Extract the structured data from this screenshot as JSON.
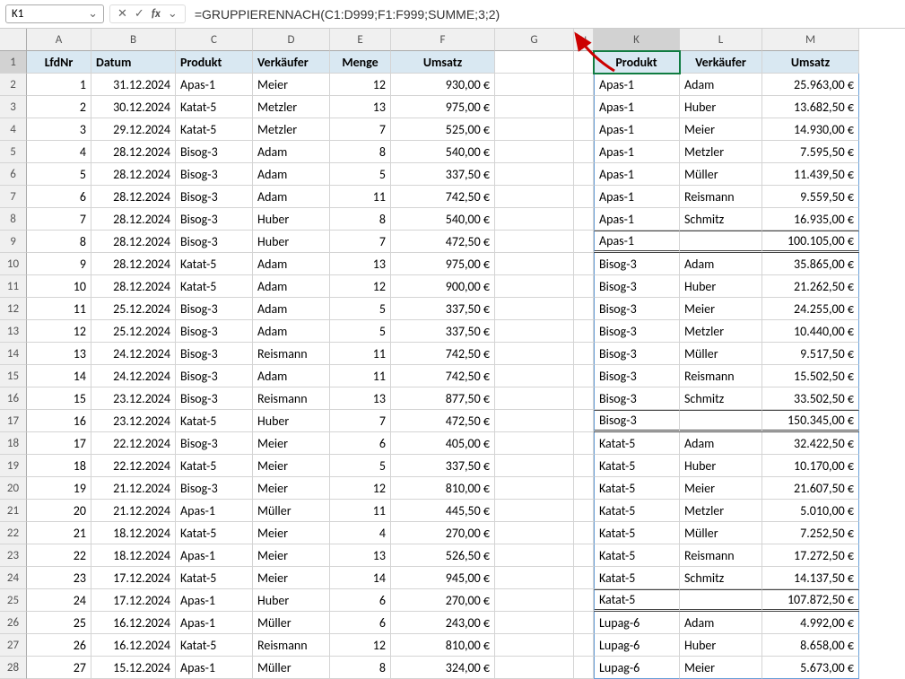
{
  "formula_bar": {
    "cell_ref": "K1",
    "formula": "=GRUPPIERENNACH(C1:D999;F1:F999;SUMME;3;2)",
    "cancel": "✕",
    "confirm": "✓",
    "fx": "fx",
    "dropdown": "⌄"
  },
  "col_letters": [
    "A",
    "B",
    "C",
    "D",
    "E",
    "F",
    "G",
    "H",
    "K",
    "L",
    "M"
  ],
  "row_numbers": [
    1,
    2,
    3,
    4,
    5,
    6,
    7,
    8,
    9,
    10,
    11,
    12,
    13,
    14,
    15,
    16,
    17,
    18,
    19,
    20,
    21,
    22,
    23,
    24,
    25,
    26,
    27,
    28
  ],
  "headers_left": [
    "LfdNr",
    "Datum",
    "Produkt",
    "Verkäufer",
    "Menge",
    "Umsatz"
  ],
  "headers_right": [
    "Produkt",
    "Verkäufer",
    "Umsatz"
  ],
  "rows_left": [
    {
      "n": 1,
      "d": "31.12.2024",
      "p": "Apas-1",
      "v": "Meier",
      "m": 12,
      "u": "930,00 €"
    },
    {
      "n": 2,
      "d": "30.12.2024",
      "p": "Katat-5",
      "v": "Metzler",
      "m": 13,
      "u": "975,00 €"
    },
    {
      "n": 3,
      "d": "29.12.2024",
      "p": "Katat-5",
      "v": "Metzler",
      "m": 7,
      "u": "525,00 €"
    },
    {
      "n": 4,
      "d": "28.12.2024",
      "p": "Bisog-3",
      "v": "Adam",
      "m": 8,
      "u": "540,00 €"
    },
    {
      "n": 5,
      "d": "28.12.2024",
      "p": "Bisog-3",
      "v": "Adam",
      "m": 5,
      "u": "337,50 €"
    },
    {
      "n": 6,
      "d": "28.12.2024",
      "p": "Bisog-3",
      "v": "Adam",
      "m": 11,
      "u": "742,50 €"
    },
    {
      "n": 7,
      "d": "28.12.2024",
      "p": "Bisog-3",
      "v": "Huber",
      "m": 8,
      "u": "540,00 €"
    },
    {
      "n": 8,
      "d": "28.12.2024",
      "p": "Bisog-3",
      "v": "Huber",
      "m": 7,
      "u": "472,50 €"
    },
    {
      "n": 9,
      "d": "28.12.2024",
      "p": "Katat-5",
      "v": "Adam",
      "m": 13,
      "u": "975,00 €"
    },
    {
      "n": 10,
      "d": "28.12.2024",
      "p": "Katat-5",
      "v": "Adam",
      "m": 12,
      "u": "900,00 €"
    },
    {
      "n": 11,
      "d": "25.12.2024",
      "p": "Bisog-3",
      "v": "Adam",
      "m": 5,
      "u": "337,50 €"
    },
    {
      "n": 12,
      "d": "25.12.2024",
      "p": "Bisog-3",
      "v": "Adam",
      "m": 5,
      "u": "337,50 €"
    },
    {
      "n": 13,
      "d": "24.12.2024",
      "p": "Bisog-3",
      "v": "Reismann",
      "m": 11,
      "u": "742,50 €"
    },
    {
      "n": 14,
      "d": "24.12.2024",
      "p": "Bisog-3",
      "v": "Adam",
      "m": 11,
      "u": "742,50 €"
    },
    {
      "n": 15,
      "d": "23.12.2024",
      "p": "Bisog-3",
      "v": "Reismann",
      "m": 13,
      "u": "877,50 €"
    },
    {
      "n": 16,
      "d": "23.12.2024",
      "p": "Katat-5",
      "v": "Huber",
      "m": 7,
      "u": "472,50 €"
    },
    {
      "n": 17,
      "d": "22.12.2024",
      "p": "Bisog-3",
      "v": "Meier",
      "m": 6,
      "u": "405,00 €"
    },
    {
      "n": 18,
      "d": "22.12.2024",
      "p": "Katat-5",
      "v": "Meier",
      "m": 5,
      "u": "337,50 €"
    },
    {
      "n": 19,
      "d": "21.12.2024",
      "p": "Bisog-3",
      "v": "Meier",
      "m": 12,
      "u": "810,00 €"
    },
    {
      "n": 20,
      "d": "21.12.2024",
      "p": "Apas-1",
      "v": "Müller",
      "m": 11,
      "u": "445,50 €"
    },
    {
      "n": 21,
      "d": "18.12.2024",
      "p": "Katat-5",
      "v": "Meier",
      "m": 4,
      "u": "270,00 €"
    },
    {
      "n": 22,
      "d": "18.12.2024",
      "p": "Apas-1",
      "v": "Meier",
      "m": 13,
      "u": "526,50 €"
    },
    {
      "n": 23,
      "d": "17.12.2024",
      "p": "Katat-5",
      "v": "Meier",
      "m": 14,
      "u": "945,00 €"
    },
    {
      "n": 24,
      "d": "17.12.2024",
      "p": "Apas-1",
      "v": "Huber",
      "m": 6,
      "u": "270,00 €"
    },
    {
      "n": 25,
      "d": "16.12.2024",
      "p": "Apas-1",
      "v": "Müller",
      "m": 6,
      "u": "243,00 €"
    },
    {
      "n": 26,
      "d": "16.12.2024",
      "p": "Katat-5",
      "v": "Reismann",
      "m": 12,
      "u": "810,00 €"
    },
    {
      "n": 27,
      "d": "15.12.2024",
      "p": "Apas-1",
      "v": "Müller",
      "m": 8,
      "u": "324,00 €"
    }
  ],
  "rows_right": [
    {
      "p": "Apas-1",
      "v": "Adam",
      "u": "25.963,00 €"
    },
    {
      "p": "Apas-1",
      "v": "Huber",
      "u": "13.682,50 €"
    },
    {
      "p": "Apas-1",
      "v": "Meier",
      "u": "14.930,00 €"
    },
    {
      "p": "Apas-1",
      "v": "Metzler",
      "u": "7.595,50 €"
    },
    {
      "p": "Apas-1",
      "v": "Müller",
      "u": "11.439,50 €"
    },
    {
      "p": "Apas-1",
      "v": "Reismann",
      "u": "9.559,50 €"
    },
    {
      "p": "Apas-1",
      "v": "Schmitz",
      "u": "16.935,00 €"
    },
    {
      "p": "Apas-1",
      "v": "",
      "u": "100.105,00 €",
      "sub": true
    },
    {
      "p": "Bisog-3",
      "v": "Adam",
      "u": "35.865,00 €"
    },
    {
      "p": "Bisog-3",
      "v": "Huber",
      "u": "21.262,50 €"
    },
    {
      "p": "Bisog-3",
      "v": "Meier",
      "u": "24.255,00 €"
    },
    {
      "p": "Bisog-3",
      "v": "Metzler",
      "u": "10.440,00 €"
    },
    {
      "p": "Bisog-3",
      "v": "Müller",
      "u": "9.517,50 €"
    },
    {
      "p": "Bisog-3",
      "v": "Reismann",
      "u": "15.502,50 €"
    },
    {
      "p": "Bisog-3",
      "v": "Schmitz",
      "u": "33.502,50 €"
    },
    {
      "p": "Bisog-3",
      "v": "",
      "u": "150.345,00 €",
      "sub": true
    },
    {
      "p": "Katat-5",
      "v": "Adam",
      "u": "32.422,50 €"
    },
    {
      "p": "Katat-5",
      "v": "Huber",
      "u": "10.170,00 €"
    },
    {
      "p": "Katat-5",
      "v": "Meier",
      "u": "21.607,50 €"
    },
    {
      "p": "Katat-5",
      "v": "Metzler",
      "u": "5.010,00 €"
    },
    {
      "p": "Katat-5",
      "v": "Müller",
      "u": "7.252,50 €"
    },
    {
      "p": "Katat-5",
      "v": "Reismann",
      "u": "17.272,50 €"
    },
    {
      "p": "Katat-5",
      "v": "Schmitz",
      "u": "14.137,50 €"
    },
    {
      "p": "Katat-5",
      "v": "",
      "u": "107.872,50 €",
      "sub": true
    },
    {
      "p": "Lupag-6",
      "v": "Adam",
      "u": "4.992,00 €"
    },
    {
      "p": "Lupag-6",
      "v": "Huber",
      "u": "8.658,00 €"
    },
    {
      "p": "Lupag-6",
      "v": "Meier",
      "u": "5.673,00 €"
    }
  ]
}
